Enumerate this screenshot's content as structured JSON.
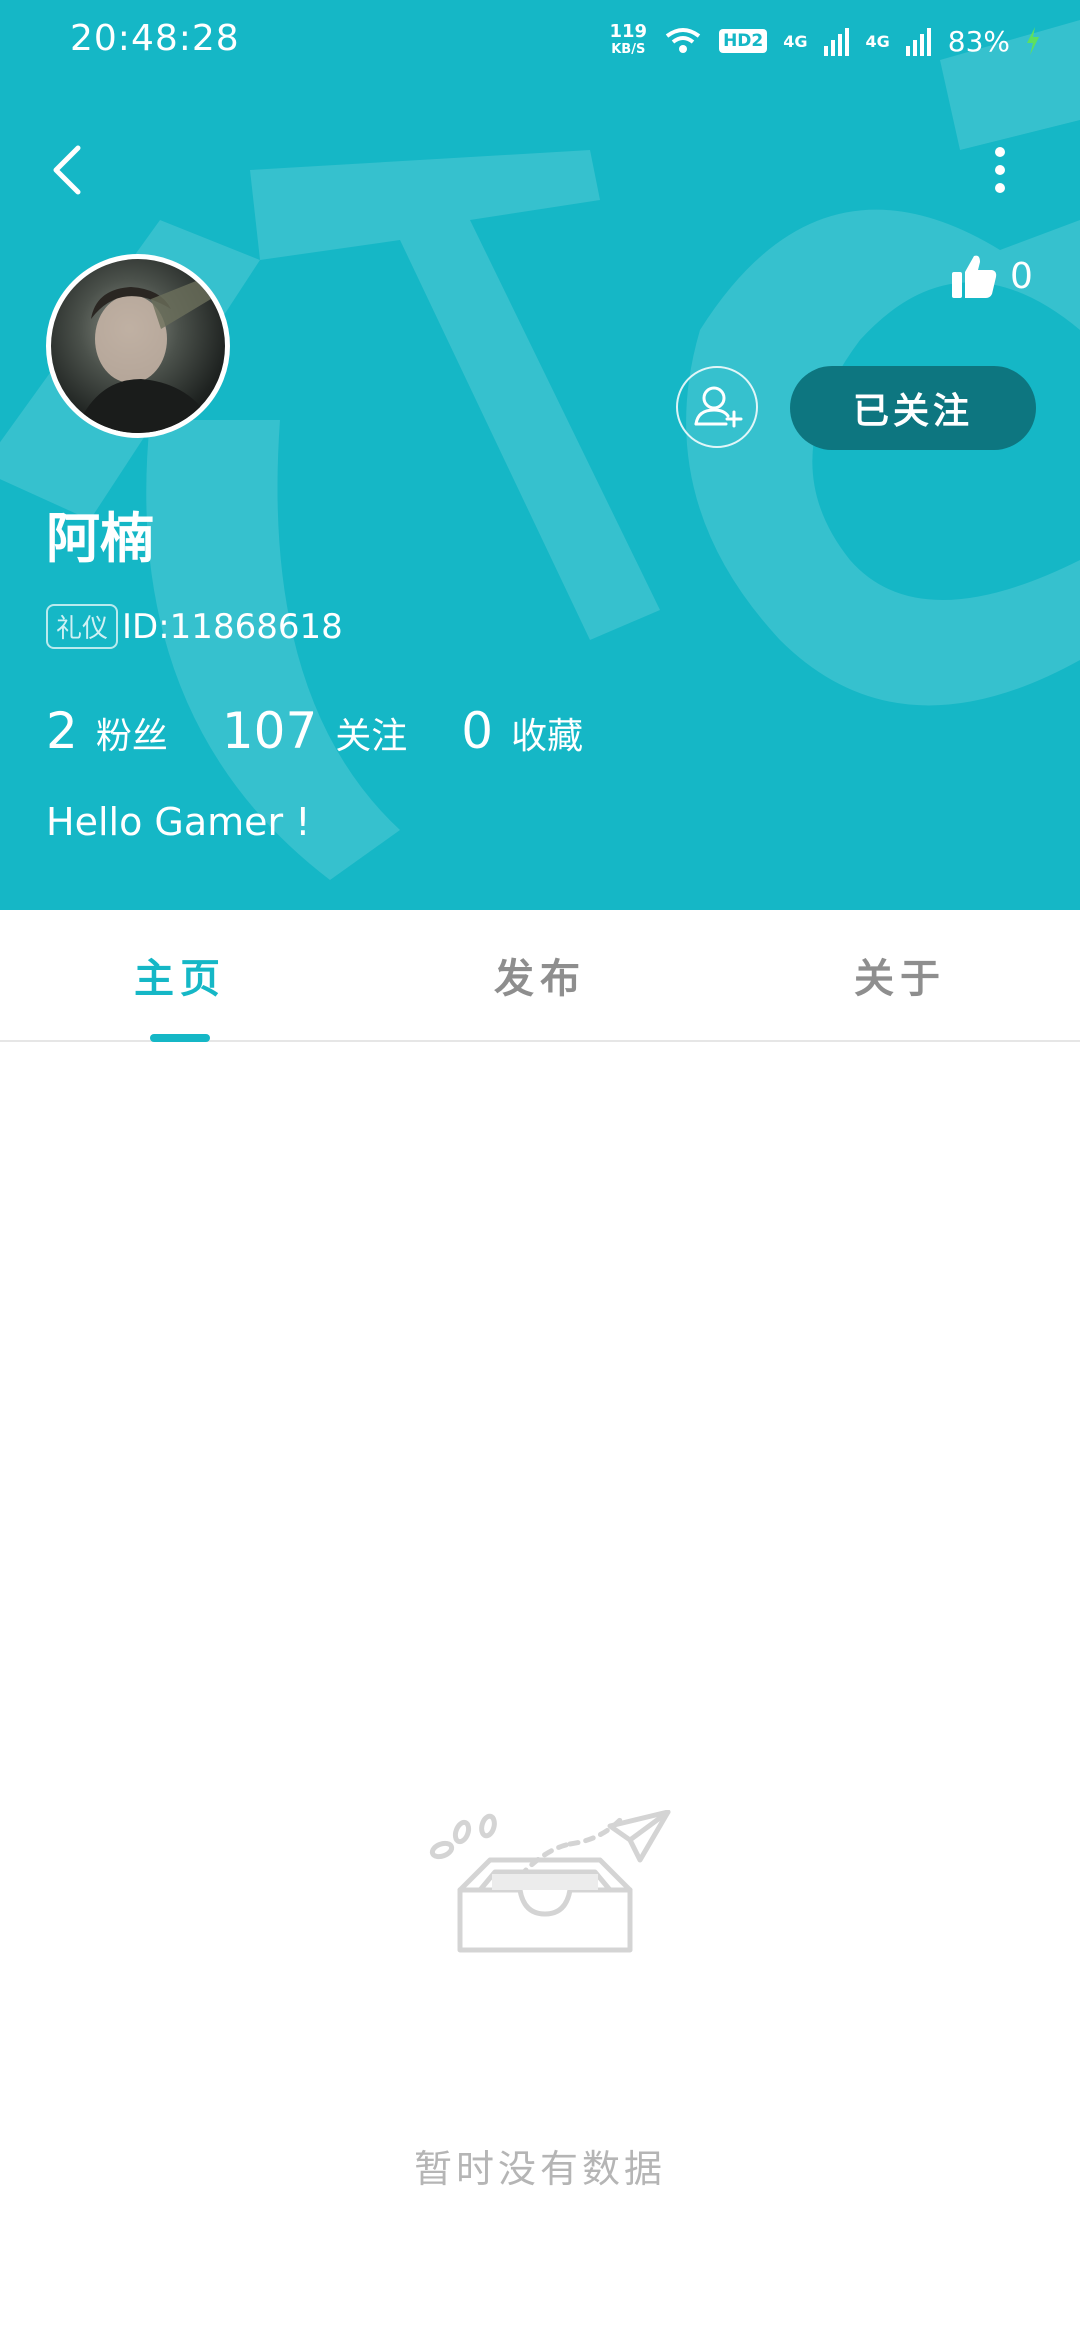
{
  "status_bar": {
    "time": "20:48:28",
    "speed_value": "119",
    "speed_unit": "KB/S",
    "hd_label": "HD2",
    "network_1": "4G",
    "network_2": "4G",
    "battery_percent": "83%"
  },
  "header": {
    "back_icon": "chevron-left-icon",
    "more_icon": "more-vertical-icon",
    "background_color": "#15b7c6"
  },
  "profile": {
    "name": "阿楠",
    "tag": "礼仪",
    "id_text": "ID:11868618",
    "likes": "0",
    "follow_button_label": "已关注",
    "bio": "Hello Gamer !",
    "stats": [
      {
        "value": "2",
        "label": "粉丝"
      },
      {
        "value": "107",
        "label": "关注"
      },
      {
        "value": "0",
        "label": "收藏"
      }
    ]
  },
  "tabs": [
    {
      "label": "主页",
      "active": true
    },
    {
      "label": "发布",
      "active": false
    },
    {
      "label": "关于",
      "active": false
    }
  ],
  "empty_state": {
    "message": "暂时没有数据",
    "icon": "empty-inbox-icon"
  }
}
